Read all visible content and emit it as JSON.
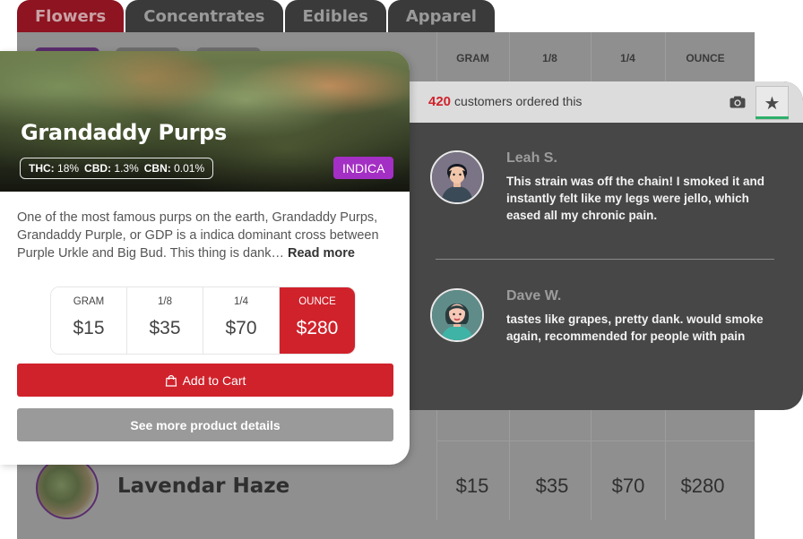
{
  "tabs": [
    {
      "label": "Flowers",
      "active": true
    },
    {
      "label": "Concentrates",
      "active": false
    },
    {
      "label": "Edibles",
      "active": false
    },
    {
      "label": "Apparel",
      "active": false
    }
  ],
  "table": {
    "headers": [
      "GRAM",
      "1/8",
      "1/4",
      "OUNCE"
    ],
    "rows": [
      {
        "name": "Lavendar Haze",
        "prices": [
          "$15",
          "$35",
          "$70",
          "$280"
        ]
      }
    ]
  },
  "product": {
    "name": "Grandaddy Purps",
    "cannabinoids": [
      {
        "label": "THC:",
        "value": "18%"
      },
      {
        "label": "CBD:",
        "value": "1.3%"
      },
      {
        "label": "CBN:",
        "value": "0.01%"
      }
    ],
    "strain": "INDICA",
    "description": "One of the most famous purps on the earth, Grandaddy Purps, Grandaddy Purple, or GDP is a  indica dominant cross between Purple Urkle and Big Bud. This thing is dank…",
    "read_more": "Read more",
    "price_options": [
      {
        "weight": "GRAM",
        "price": "$15",
        "selected": false
      },
      {
        "weight": "1/8",
        "price": "$35",
        "selected": false
      },
      {
        "weight": "1/4",
        "price": "$70",
        "selected": false
      },
      {
        "weight": "OUNCE",
        "price": "$280",
        "selected": true
      }
    ],
    "add_to_cart": "Add to Cart",
    "see_more": "See more product details"
  },
  "reviews": {
    "count": "420",
    "count_label": "customers ordered this",
    "icons": [
      "camera-icon",
      "star-icon"
    ],
    "items": [
      {
        "name": "Leah S.",
        "text": "This strain was off the chain! I smoked it and instantly felt like my legs were jello, which eased all my chronic pain."
      },
      {
        "name": "Dave W.",
        "text": "tastes like grapes, pretty dank. would smoke again, recommended for people with pain"
      }
    ]
  },
  "colors": {
    "accent_red": "#d0222b",
    "indica_purple": "#a42fc4",
    "active_tab": "#8d1420",
    "panel_dark": "#474747",
    "highlight_green": "#2fb06b"
  }
}
